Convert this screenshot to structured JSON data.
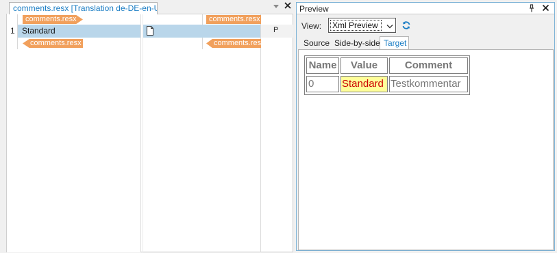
{
  "editor": {
    "tab_title": "comments.resx [Translation de-DE-en-US]",
    "source_open_tag": "comments.resx",
    "source_close_tag": "comments.resx",
    "target_open_tag": "comments.resx",
    "target_close_tag": "comments.resx",
    "rows": [
      {
        "number": "1",
        "source": "Standard",
        "status": "P"
      }
    ]
  },
  "preview": {
    "title": "Preview",
    "view_label": "View:",
    "view_selected": "Xml Preview",
    "tabs": [
      "Source",
      "Side-by-side",
      "Target"
    ],
    "active_tab": "Target",
    "table": {
      "headers": [
        "Name",
        "Value",
        "Comment"
      ],
      "rows": [
        [
          "0",
          "Standard",
          "Testkommentar"
        ]
      ]
    }
  },
  "colors": {
    "accent": "#1a7dc4",
    "tag": "#f1a05c",
    "row_highlight": "#b9d6ea",
    "value_highlight": "#ffff99",
    "value_text": "#cc0000"
  },
  "icons": [
    "document-icon",
    "refresh-icon",
    "pin-icon",
    "close-icon",
    "dropdown-arrow-icon"
  ]
}
